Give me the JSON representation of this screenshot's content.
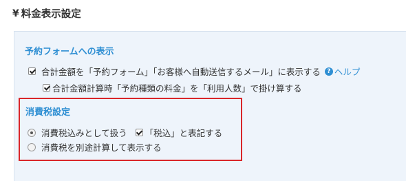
{
  "header": {
    "icon": "yen-icon",
    "icon_glyph": "¥",
    "title": "料金表示設定"
  },
  "display_section": {
    "title": "予約フォームへの表示",
    "show_total": {
      "checked": true,
      "label": "合計金額を「予約フォーム」「お客様へ自動送信するメール」に表示する"
    },
    "help": {
      "icon": "help-icon",
      "icon_glyph": "?",
      "label": "ヘルプ"
    },
    "multiply_by_people": {
      "checked": true,
      "label": "合計金額計算時「予約種類の料金」を「利用人数」で掛け算する"
    }
  },
  "tax_section": {
    "title": "消費税設定",
    "options": [
      {
        "label": "消費税込みとして扱う",
        "selected": true
      },
      {
        "label": "消費税を別途計算して表示する",
        "selected": false
      }
    ],
    "tax_included_label": {
      "checked": true,
      "label": "「税込」と表記する"
    }
  },
  "colors": {
    "accent": "#2f8fd3",
    "panel_bg": "#eef4fb",
    "highlight_border": "#d9262a"
  }
}
